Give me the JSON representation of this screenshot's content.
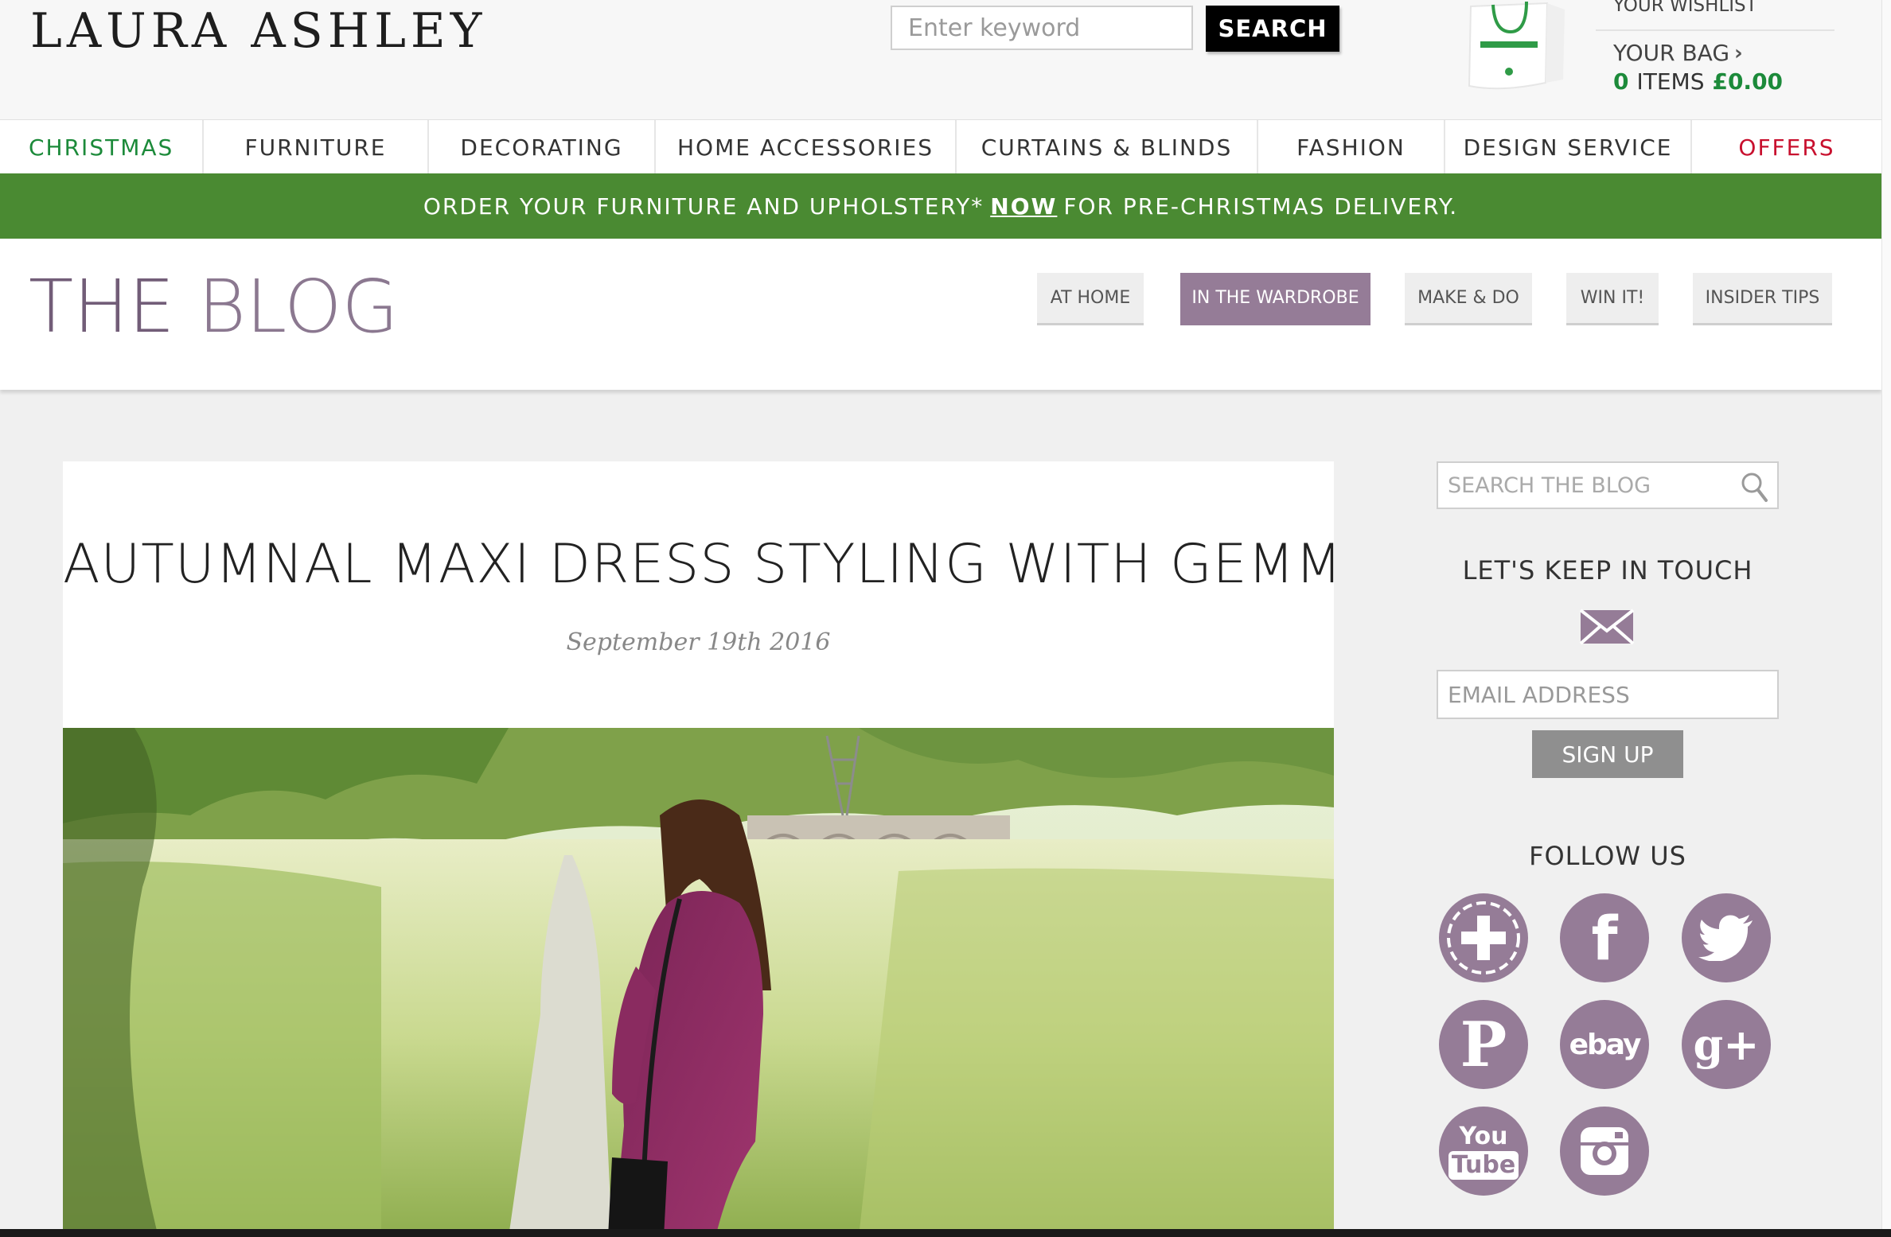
{
  "brand": {
    "logo_text": "LAURA ASHLEY"
  },
  "search": {
    "placeholder": "Enter keyword",
    "button_label": "SEARCH"
  },
  "account": {
    "wishlist": "YOUR WISHLIST",
    "bag_label": "YOUR BAG",
    "bag_count": "0",
    "items_label": "ITEMS",
    "bag_total": "£0.00"
  },
  "nav": {
    "items": [
      {
        "label": "CHRISTMAS",
        "color": "#1c8a3a"
      },
      {
        "label": "FURNITURE",
        "color": "#333333"
      },
      {
        "label": "DECORATING",
        "color": "#333333"
      },
      {
        "label": "HOME ACCESSORIES",
        "color": "#333333"
      },
      {
        "label": "CURTAINS & BLINDS",
        "color": "#333333"
      },
      {
        "label": "FASHION",
        "color": "#333333"
      },
      {
        "label": "DESIGN SERVICE",
        "color": "#333333"
      },
      {
        "label": "OFFERS",
        "color": "#c8102e"
      }
    ]
  },
  "promo": {
    "before": "ORDER YOUR FURNITURE AND UPHOLSTERY*",
    "link": "NOW",
    "after": "FOR PRE-CHRISTMAS DELIVERY.",
    "background": "#4a8a32"
  },
  "blog": {
    "title_bold": "THE",
    "title_light": "BLOG",
    "tabs": [
      {
        "label": "AT HOME"
      },
      {
        "label": "IN THE WARDROBE",
        "active": true
      },
      {
        "label": "MAKE & DO"
      },
      {
        "label": "WIN IT!"
      },
      {
        "label": "INSIDER TIPS"
      }
    ],
    "accent": "#957c97"
  },
  "article": {
    "title": "AUTUMNAL MAXI DRESS STYLING WITH GEMMA",
    "date": "September 19th 2016"
  },
  "sidebar": {
    "search_placeholder": "SEARCH THE BLOG",
    "touch_heading": "LET'S KEEP IN TOUCH",
    "email_placeholder": "EMAIL ADDRESS",
    "signup_label": "SIGN UP",
    "follow_heading": "FOLLOW US",
    "social": [
      {
        "icon": "bloglovin-plus-icon"
      },
      {
        "icon": "facebook-icon",
        "glyph": "f"
      },
      {
        "icon": "twitter-icon"
      },
      {
        "icon": "pinterest-icon",
        "glyph": "P"
      },
      {
        "icon": "ebay-icon",
        "glyph": "ebay"
      },
      {
        "icon": "google-plus-icon",
        "glyph": "g+"
      },
      {
        "icon": "youtube-icon",
        "glyph_top": "You",
        "glyph_bottom": "Tube"
      },
      {
        "icon": "instagram-icon"
      }
    ]
  }
}
